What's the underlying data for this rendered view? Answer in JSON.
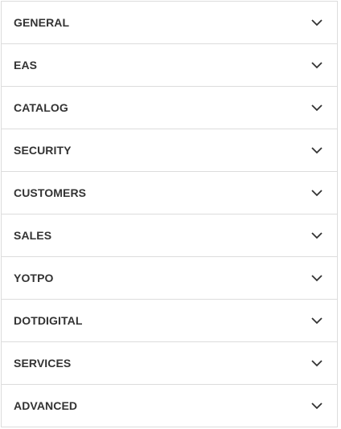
{
  "sections": [
    {
      "label": "GENERAL",
      "icon": "chevron-down-icon"
    },
    {
      "label": "EAS",
      "icon": "chevron-down-icon"
    },
    {
      "label": "CATALOG",
      "icon": "chevron-down-icon"
    },
    {
      "label": "SECURITY",
      "icon": "chevron-down-icon"
    },
    {
      "label": "CUSTOMERS",
      "icon": "chevron-down-icon"
    },
    {
      "label": "SALES",
      "icon": "chevron-down-icon"
    },
    {
      "label": "YOTPO",
      "icon": "chevron-down-icon"
    },
    {
      "label": "DOTDIGITAL",
      "icon": "chevron-down-icon"
    },
    {
      "label": "SERVICES",
      "icon": "chevron-down-icon"
    },
    {
      "label": "ADVANCED",
      "icon": "chevron-down-icon"
    }
  ],
  "colors": {
    "text": "#333333",
    "border": "#dcdcdc",
    "background": "#ffffff"
  }
}
